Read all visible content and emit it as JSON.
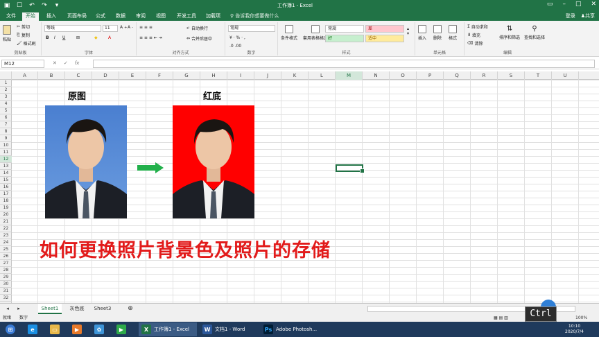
{
  "window": {
    "title": "工作簿1 - Excel",
    "login": "登录",
    "share": "共享"
  },
  "tabs": [
    "文件",
    "开始",
    "插入",
    "页面布局",
    "公式",
    "数据",
    "审阅",
    "视图",
    "开发工具",
    "加载项"
  ],
  "active_tab": "开始",
  "tell_me": "告诉我你想要做什么",
  "ribbon": {
    "clipboard": {
      "label": "剪贴板",
      "paste": "粘贴",
      "cut": "剪切",
      "copy": "复制",
      "format_painter": "格式刷"
    },
    "font": {
      "label": "字体",
      "name": "等线",
      "size": "11"
    },
    "alignment": {
      "label": "对齐方式",
      "wrap": "自动换行",
      "merge": "合并后居中"
    },
    "number": {
      "label": "数字",
      "format": "常规"
    },
    "styles": {
      "label": "样式",
      "conditional": "条件格式",
      "table": "套用表格格式",
      "normal": "常规",
      "bad": "差",
      "good": "好",
      "neutral": "适中"
    },
    "cells": {
      "label": "单元格",
      "insert": "插入",
      "delete": "删除",
      "format": "格式"
    },
    "editing": {
      "label": "编辑",
      "autosum": "自动求和",
      "fill": "填充",
      "clear": "清除",
      "sort": "排序和筛选",
      "find": "查找和选择"
    }
  },
  "formula_bar": {
    "name_box": "M12",
    "formula": ""
  },
  "columns": [
    "A",
    "B",
    "C",
    "D",
    "E",
    "F",
    "G",
    "H",
    "I",
    "J",
    "K",
    "L",
    "M",
    "N",
    "O",
    "P",
    "Q",
    "R",
    "S",
    "T",
    "U"
  ],
  "rows": [
    "1",
    "2",
    "3",
    "4",
    "5",
    "6",
    "7",
    "8",
    "9",
    "10",
    "11",
    "12",
    "13",
    "14",
    "15",
    "16",
    "17",
    "18",
    "19",
    "20",
    "21",
    "22",
    "23",
    "24",
    "25",
    "26",
    "27",
    "28",
    "29",
    "30",
    "31",
    "32"
  ],
  "content": {
    "label_original": "原图",
    "label_red": "红底",
    "headline": "如何更换照片背景色及照片的存储"
  },
  "sheets": [
    "Sheet1",
    "灰色底",
    "Sheet3"
  ],
  "active_sheet": "Sheet1",
  "status": {
    "left1": "就绪",
    "left2": "数字",
    "zoom": "100%"
  },
  "taskbar": {
    "items": [
      "工作簿1 - Excel",
      "文档1 - Word",
      "Adobe Photosh..."
    ],
    "time": "10:10",
    "date": "2020/7/4"
  },
  "overlay": {
    "key": "Ctrl"
  },
  "colors": {
    "excel_green": "#217346",
    "photo_left_bg": "#5b8fd6",
    "photo_right_bg": "#ff0000",
    "arrow": "#22b04b",
    "headline": "#e21b1b"
  }
}
